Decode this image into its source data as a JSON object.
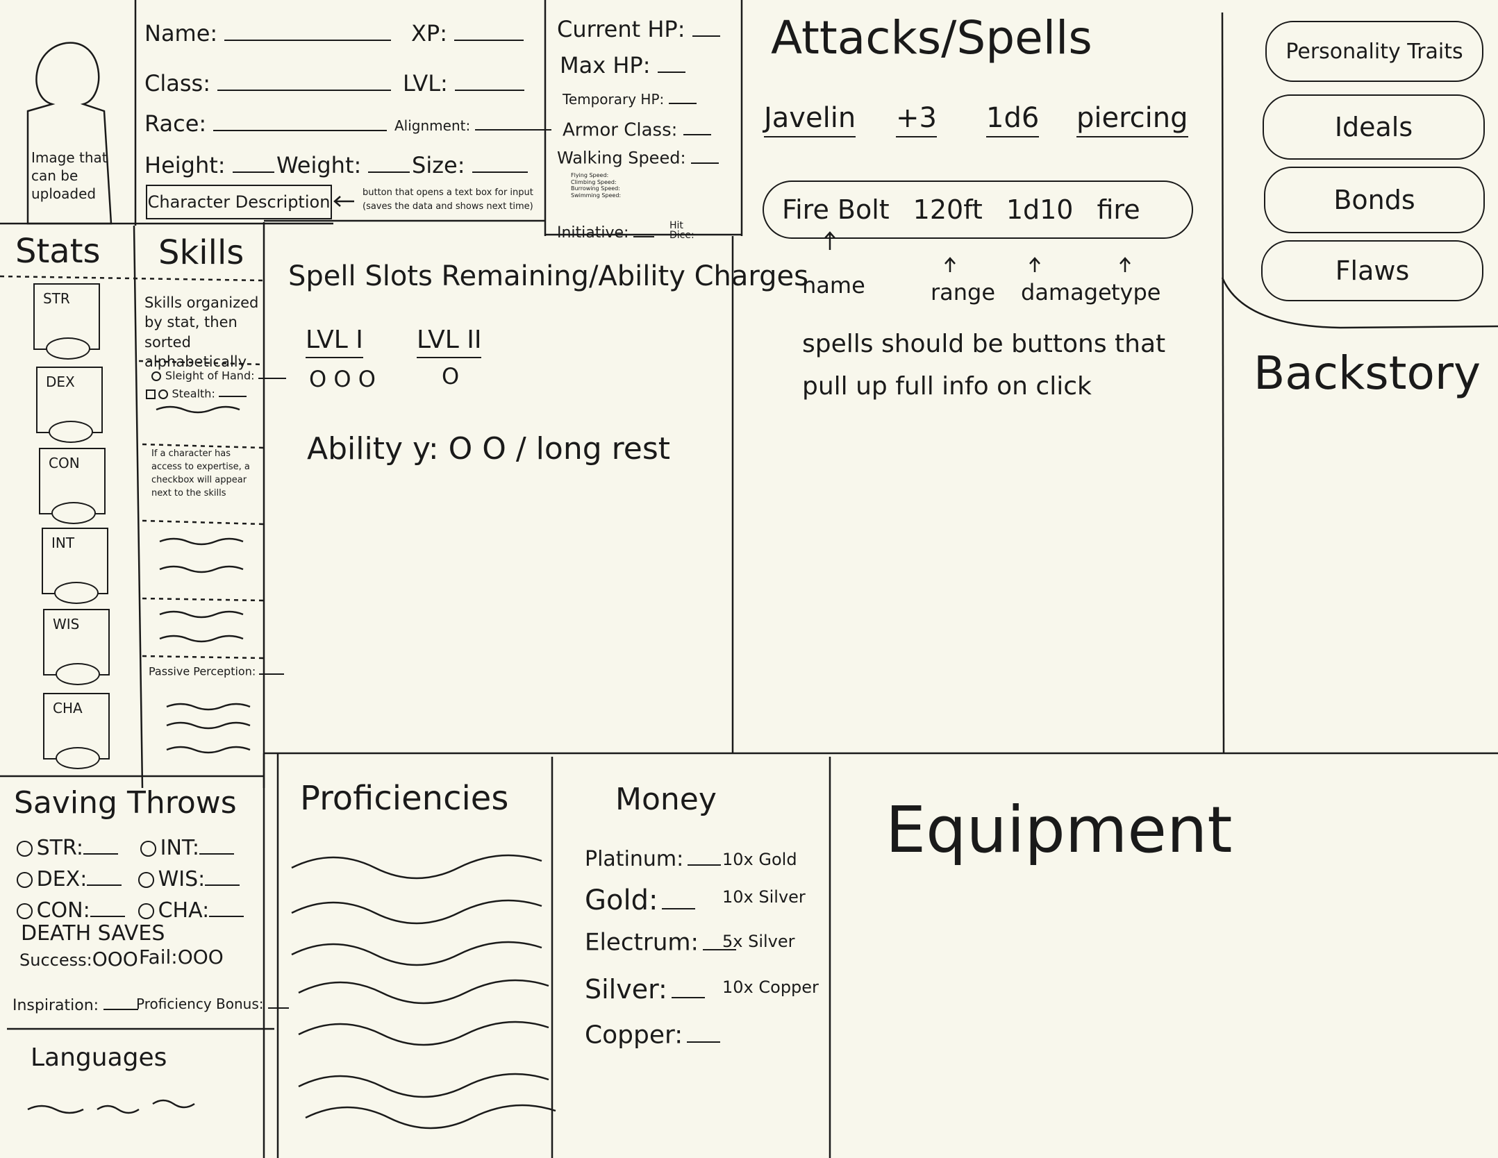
{
  "header": {
    "portrait_label": "Image that can be uploaded",
    "name_label": "Name:",
    "xp_label": "XP:",
    "class_label": "Class:",
    "lvl_label": "LVL:",
    "race_label": "Race:",
    "alignment_label": "Alignment:",
    "height_label": "Height:",
    "weight_label": "Weight:",
    "size_label": "Size:",
    "char_desc_button": "Character Description",
    "char_desc_note": "button that opens a text box for input (saves the data and shows next time)"
  },
  "vitals": {
    "current_hp": "Current HP:",
    "max_hp": "Max HP:",
    "temp_hp": "Temporary HP:",
    "armor_class": "Armor Class:",
    "walking_speed": "Walking Speed:",
    "other_speeds": [
      "Flying Speed:",
      "Climbing Speed:",
      "Burrowing Speed:",
      "Swimming Speed:"
    ],
    "initiative": "Initiative:",
    "hit_dice": "Hit Dice:"
  },
  "stats": {
    "heading": "Stats",
    "items": [
      "STR",
      "DEX",
      "CON",
      "INT",
      "WIS",
      "CHA"
    ]
  },
  "skills": {
    "heading": "Skills",
    "note": "Skills organized by stat, then sorted alphabetically",
    "sleight": "Sleight of Hand:",
    "stealth": "Stealth:",
    "expertise_note": "If a character has access to expertise, a checkbox will appear next to the skills",
    "passive_perception": "Passive Perception:"
  },
  "spell_slots": {
    "heading": "Spell Slots Remaining/Ability Charges",
    "lvl1": "LVL I",
    "lvl1_pips": "O O O",
    "lvl2": "LVL II",
    "lvl2_pips": "O",
    "ability": "Ability y: O O / long rest"
  },
  "attacks": {
    "heading": "Attacks/Spells",
    "javelin": {
      "name": "Javelin",
      "bonus": "+3",
      "damage": "1d6",
      "type": "piercing"
    },
    "firebolt": {
      "name": "Fire Bolt",
      "range": "120ft",
      "damage": "1d10",
      "type": "fire"
    },
    "annotations": {
      "name": "name",
      "range": "range",
      "damage": "damage",
      "type": "type"
    },
    "note": "spells should be buttons that pull up full info on click"
  },
  "traits": {
    "personality": "Personality Traits",
    "ideals": "Ideals",
    "bonds": "Bonds",
    "flaws": "Flaws",
    "backstory": "Backstory"
  },
  "saving_throws": {
    "heading": "Saving Throws",
    "str": "STR:",
    "int": "INT:",
    "dex": "DEX:",
    "wis": "WIS:",
    "con": "CON:",
    "cha": "CHA:",
    "death_saves": "DEATH SAVES",
    "success": "Success:",
    "success_pips": "OOO",
    "fail": "Fail:",
    "fail_pips": "OOO",
    "inspiration": "Inspiration:",
    "proficiency_bonus": "Proficiency Bonus:"
  },
  "languages": {
    "heading": "Languages"
  },
  "proficiencies": {
    "heading": "Proficiencies"
  },
  "money": {
    "heading": "Money",
    "rows": [
      {
        "label": "Platinum:",
        "note": "10x Gold"
      },
      {
        "label": "Gold:",
        "note": "10x Silver"
      },
      {
        "label": "Electrum:",
        "note": "5x Silver"
      },
      {
        "label": "Silver:",
        "note": "10x Copper"
      },
      {
        "label": "Copper:",
        "note": ""
      }
    ]
  },
  "equipment": {
    "heading": "Equipment"
  }
}
